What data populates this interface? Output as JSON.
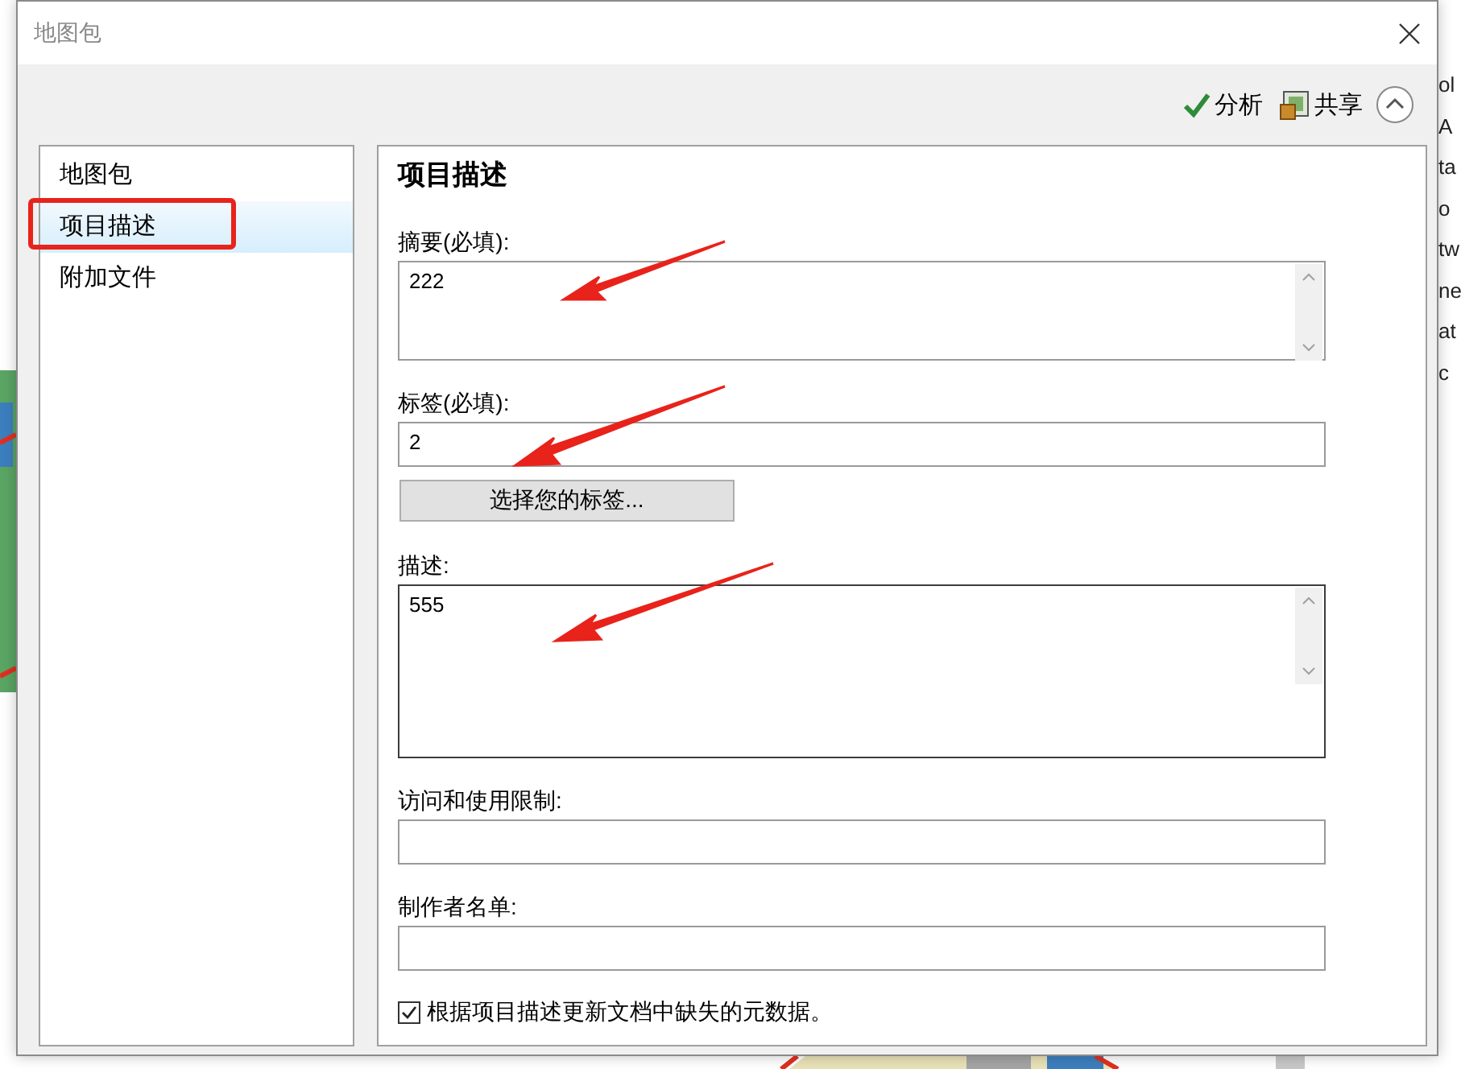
{
  "window": {
    "title": "地图包"
  },
  "toolbar": [
    {
      "kind": "analyze",
      "label": "分析"
    },
    {
      "kind": "share",
      "label": "共享"
    },
    {
      "kind": "collapse"
    }
  ],
  "sidebar": {
    "items": [
      {
        "label": "地图包",
        "selected": false
      },
      {
        "label": "项目描述",
        "selected": true
      },
      {
        "label": "附加文件",
        "selected": false
      }
    ]
  },
  "form": {
    "title": "项目描述",
    "fields": [
      {
        "kind": "textarea",
        "label": "摘要(必填):",
        "value": "222",
        "focused": false
      },
      {
        "kind": "input",
        "label": "标签(必填):",
        "value": "2"
      },
      {
        "kind": "button",
        "label": "选择您的标签..."
      },
      {
        "kind": "textarea",
        "label": "描述:",
        "value": "555",
        "focused": true
      },
      {
        "kind": "input",
        "label": "访问和使用限制:"
      },
      {
        "kind": "input",
        "label": "制作者名单:"
      }
    ],
    "checkbox": {
      "label": "根据项目描述更新文档中缺失的元数据。",
      "checked": true
    }
  },
  "background_text": [
    "ol",
    "A",
    "ta",
    "o",
    "tw",
    "ne",
    "at",
    "c"
  ]
}
